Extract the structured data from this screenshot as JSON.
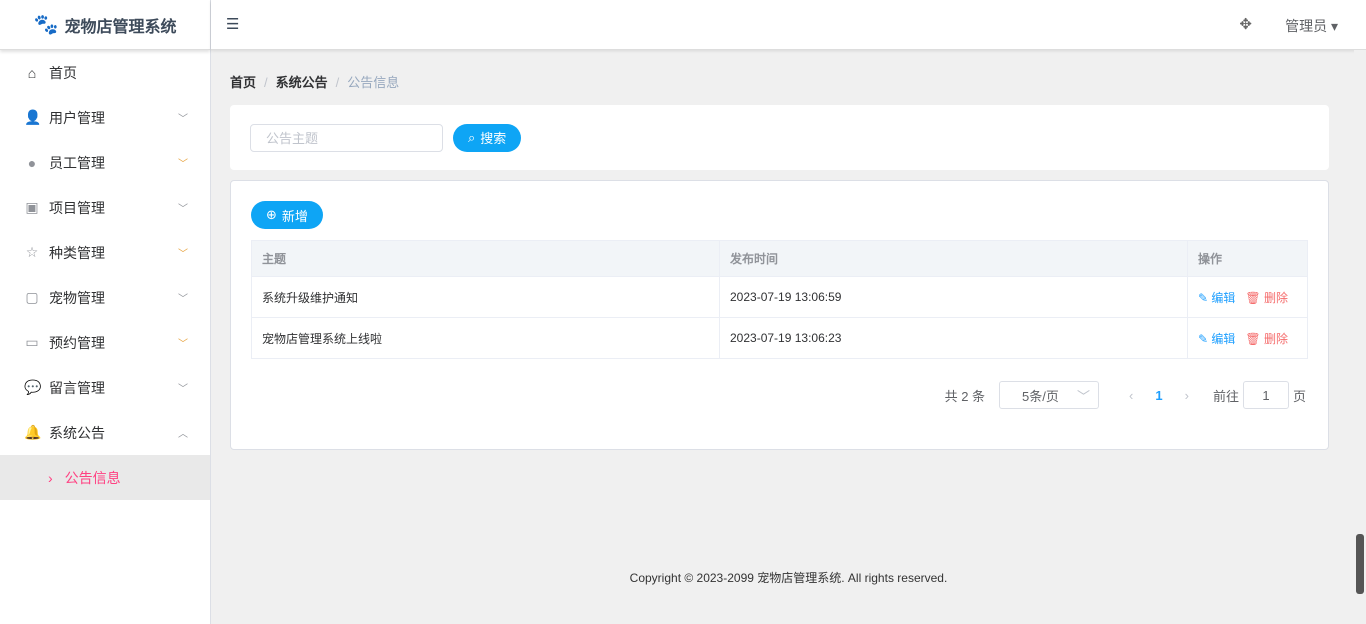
{
  "app": {
    "title": "宠物店管理系统"
  },
  "sidebar": {
    "items": [
      {
        "label": "首页",
        "icon": "home-icon"
      },
      {
        "label": "用户管理",
        "icon": "user-icon"
      },
      {
        "label": "员工管理",
        "icon": "staff-icon"
      },
      {
        "label": "项目管理",
        "icon": "project-icon"
      },
      {
        "label": "种类管理",
        "icon": "star-icon"
      },
      {
        "label": "宠物管理",
        "icon": "pet-icon"
      },
      {
        "label": "预约管理",
        "icon": "appointment-icon"
      },
      {
        "label": "留言管理",
        "icon": "message-icon"
      },
      {
        "label": "系统公告",
        "icon": "bell-icon"
      }
    ],
    "sub_item": "公告信息"
  },
  "header": {
    "user": "管理员"
  },
  "breadcrumb": [
    "首页",
    "系统公告",
    "公告信息"
  ],
  "search": {
    "placeholder": "公告主题",
    "button": "搜索"
  },
  "toolbar": {
    "add": "新增"
  },
  "table": {
    "headers": [
      "主题",
      "发布时间",
      "操作"
    ],
    "rows": [
      {
        "title": "系统升级维护通知",
        "time": "2023-07-19 13:06:59"
      },
      {
        "title": "宠物店管理系统上线啦",
        "time": "2023-07-19 13:06:23"
      }
    ],
    "edit": "编辑",
    "delete": "删除"
  },
  "pager": {
    "total": "共 2 条",
    "size": "5条/页",
    "current": "1",
    "goto": "前往",
    "jump_value": "1",
    "page_suffix": "页"
  },
  "footer": "Copyright © 2023-2099 宠物店管理系统. All rights reserved."
}
